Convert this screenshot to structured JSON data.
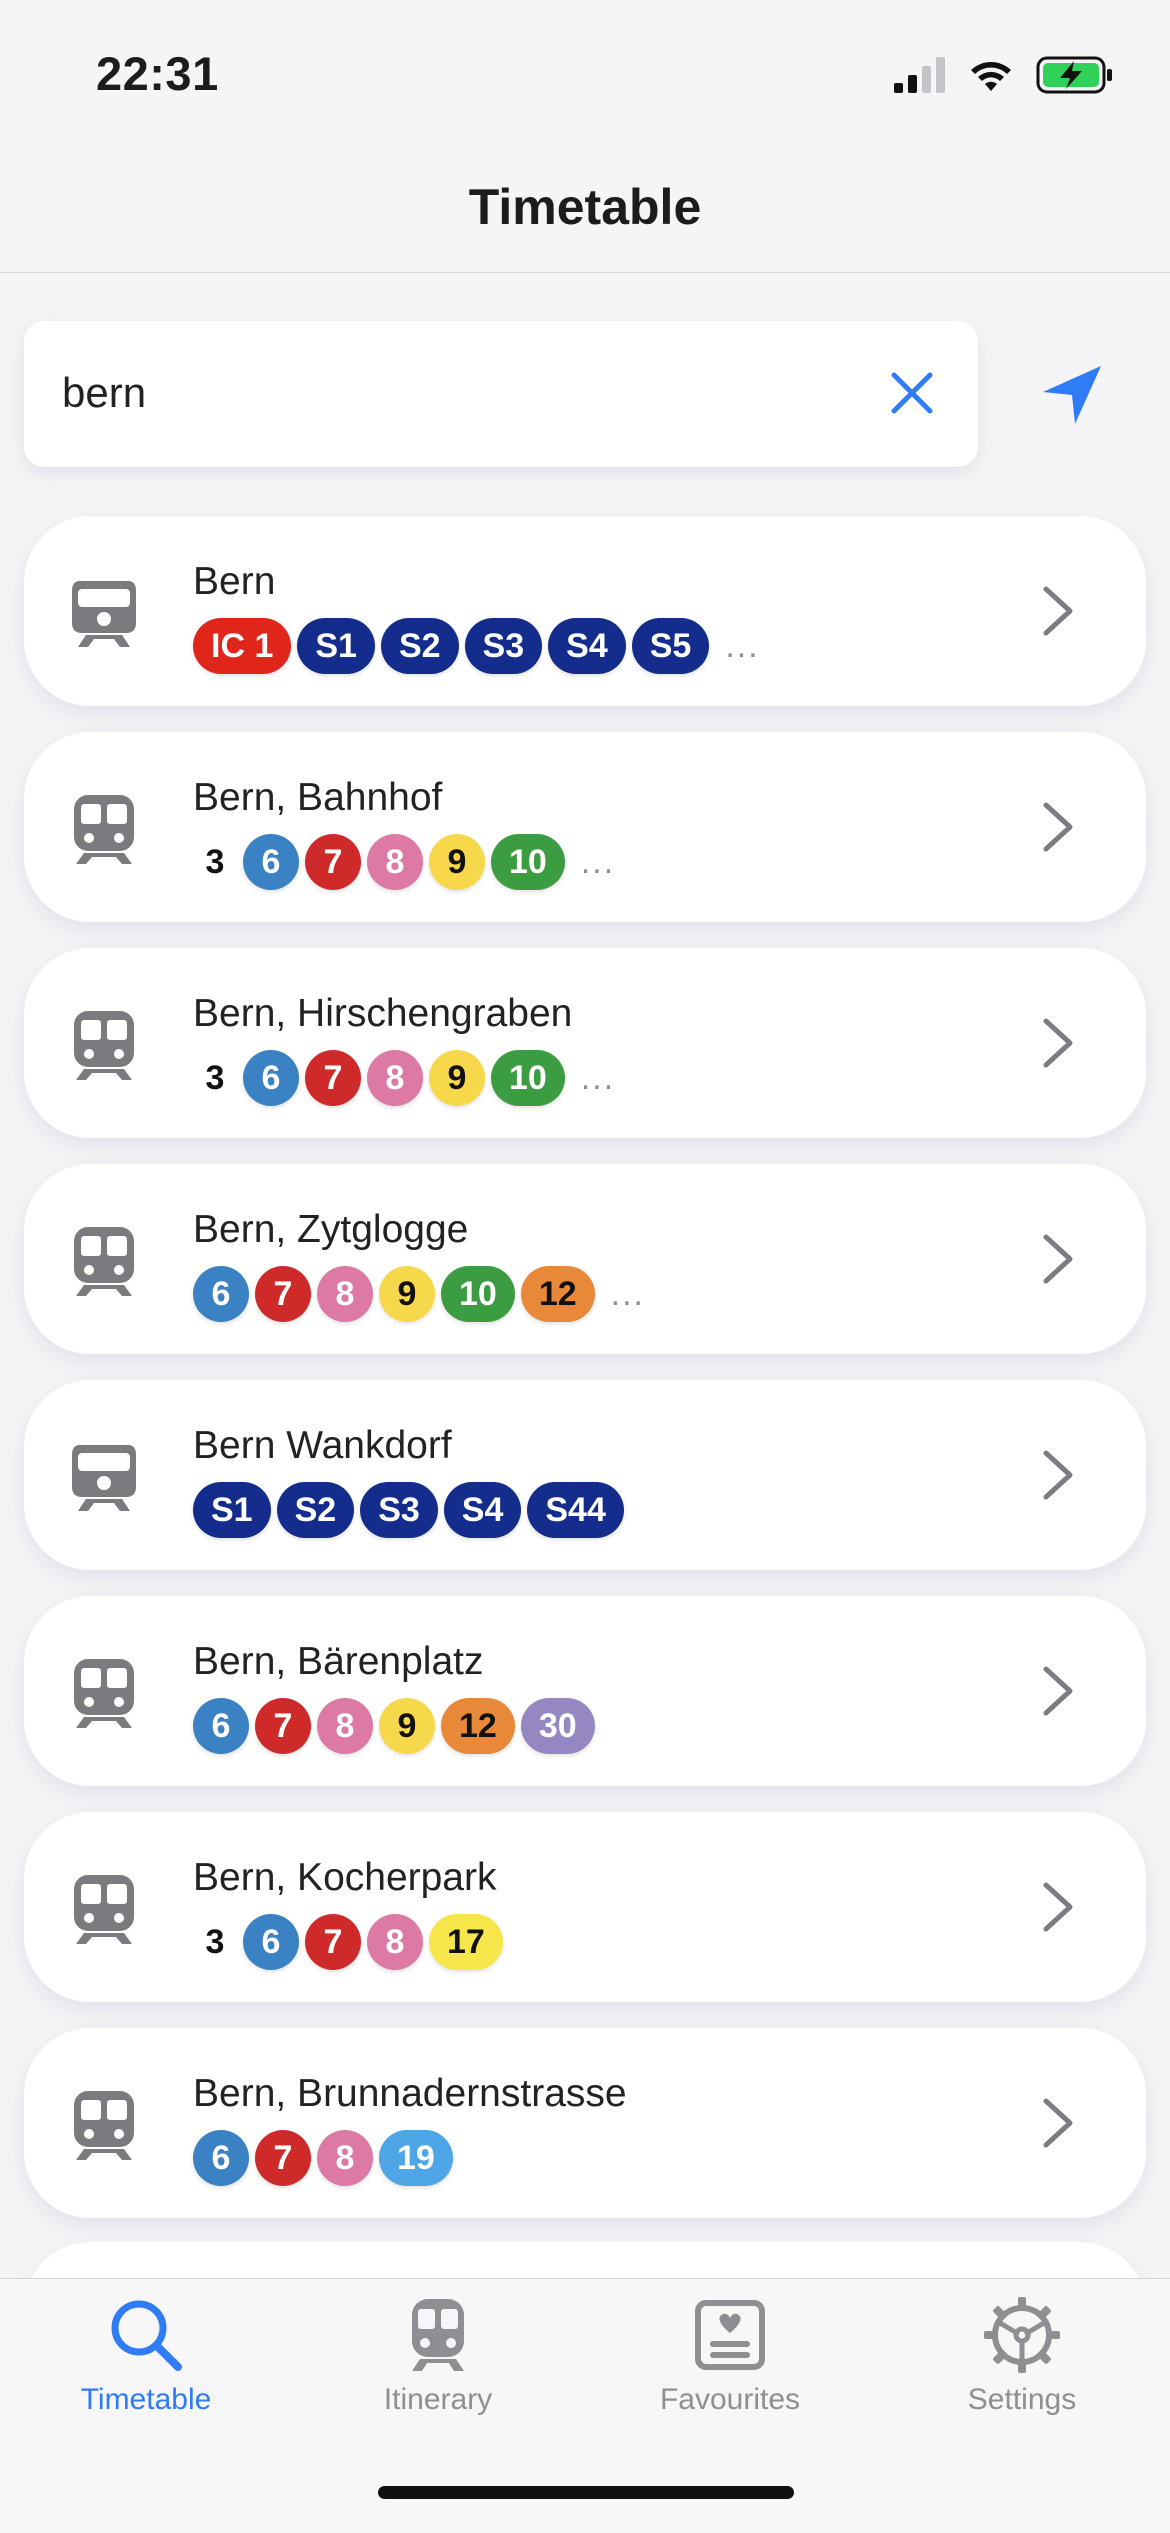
{
  "status": {
    "time": "22:31"
  },
  "nav": {
    "title": "Timetable"
  },
  "search": {
    "value": "bern",
    "clear_icon": "close-icon",
    "location_icon": "location-arrow-icon"
  },
  "colors": {
    "accent": "#2f7cf6",
    "card": "#ffffff",
    "background": "#f5f5f7"
  },
  "results": [
    {
      "name": "Bern",
      "icon": "train-icon",
      "lines": [
        {
          "label": "IC 1",
          "color": "#e0251b",
          "text": "#ffffff",
          "shape": "pill"
        },
        {
          "label": "S1",
          "color": "#142d8c",
          "text": "#ffffff",
          "shape": "pill"
        },
        {
          "label": "S2",
          "color": "#142d8c",
          "text": "#ffffff",
          "shape": "pill"
        },
        {
          "label": "S3",
          "color": "#142d8c",
          "text": "#ffffff",
          "shape": "pill"
        },
        {
          "label": "S4",
          "color": "#142d8c",
          "text": "#ffffff",
          "shape": "pill"
        },
        {
          "label": "S5",
          "color": "#142d8c",
          "text": "#ffffff",
          "shape": "pill"
        }
      ],
      "more": "..."
    },
    {
      "name": "Bern, Bahnhof",
      "icon": "tram-icon",
      "lines": [
        {
          "label": "3",
          "color": "transparent",
          "text": "#111111",
          "shape": "plain"
        },
        {
          "label": "6",
          "color": "#3a82c4",
          "text": "#ffffff",
          "shape": "circle"
        },
        {
          "label": "7",
          "color": "#cf2a2a",
          "text": "#ffffff",
          "shape": "circle"
        },
        {
          "label": "8",
          "color": "#dc7aa5",
          "text": "#ffffff",
          "shape": "circle"
        },
        {
          "label": "9",
          "color": "#f7d84a",
          "text": "#111111",
          "shape": "circle"
        },
        {
          "label": "10",
          "color": "#3c9c42",
          "text": "#ffffff",
          "shape": "pill"
        }
      ],
      "more": "..."
    },
    {
      "name": "Bern, Hirschengraben",
      "icon": "tram-icon",
      "lines": [
        {
          "label": "3",
          "color": "transparent",
          "text": "#111111",
          "shape": "plain"
        },
        {
          "label": "6",
          "color": "#3a82c4",
          "text": "#ffffff",
          "shape": "circle"
        },
        {
          "label": "7",
          "color": "#cf2a2a",
          "text": "#ffffff",
          "shape": "circle"
        },
        {
          "label": "8",
          "color": "#dc7aa5",
          "text": "#ffffff",
          "shape": "circle"
        },
        {
          "label": "9",
          "color": "#f7d84a",
          "text": "#111111",
          "shape": "circle"
        },
        {
          "label": "10",
          "color": "#3c9c42",
          "text": "#ffffff",
          "shape": "pill"
        }
      ],
      "more": "..."
    },
    {
      "name": "Bern, Zytglogge",
      "icon": "tram-icon",
      "lines": [
        {
          "label": "6",
          "color": "#3a82c4",
          "text": "#ffffff",
          "shape": "circle"
        },
        {
          "label": "7",
          "color": "#cf2a2a",
          "text": "#ffffff",
          "shape": "circle"
        },
        {
          "label": "8",
          "color": "#dc7aa5",
          "text": "#ffffff",
          "shape": "circle"
        },
        {
          "label": "9",
          "color": "#f7d84a",
          "text": "#111111",
          "shape": "circle"
        },
        {
          "label": "10",
          "color": "#3c9c42",
          "text": "#ffffff",
          "shape": "pill"
        },
        {
          "label": "12",
          "color": "#e8893a",
          "text": "#111111",
          "shape": "pill"
        }
      ],
      "more": "..."
    },
    {
      "name": "Bern Wankdorf",
      "icon": "train-icon",
      "lines": [
        {
          "label": "S1",
          "color": "#142d8c",
          "text": "#ffffff",
          "shape": "pill"
        },
        {
          "label": "S2",
          "color": "#142d8c",
          "text": "#ffffff",
          "shape": "pill"
        },
        {
          "label": "S3",
          "color": "#142d8c",
          "text": "#ffffff",
          "shape": "pill"
        },
        {
          "label": "S4",
          "color": "#142d8c",
          "text": "#ffffff",
          "shape": "pill"
        },
        {
          "label": "S44",
          "color": "#142d8c",
          "text": "#ffffff",
          "shape": "pill"
        }
      ],
      "more": ""
    },
    {
      "name": "Bern, Bärenplatz",
      "icon": "tram-icon",
      "lines": [
        {
          "label": "6",
          "color": "#3a82c4",
          "text": "#ffffff",
          "shape": "circle"
        },
        {
          "label": "7",
          "color": "#cf2a2a",
          "text": "#ffffff",
          "shape": "circle"
        },
        {
          "label": "8",
          "color": "#dc7aa5",
          "text": "#ffffff",
          "shape": "circle"
        },
        {
          "label": "9",
          "color": "#f7d84a",
          "text": "#111111",
          "shape": "circle"
        },
        {
          "label": "12",
          "color": "#e8893a",
          "text": "#111111",
          "shape": "pill"
        },
        {
          "label": "30",
          "color": "#9487c2",
          "text": "#ffffff",
          "shape": "pill"
        }
      ],
      "more": ""
    },
    {
      "name": "Bern, Kocherpark",
      "icon": "tram-icon",
      "lines": [
        {
          "label": "3",
          "color": "transparent",
          "text": "#111111",
          "shape": "plain"
        },
        {
          "label": "6",
          "color": "#3a82c4",
          "text": "#ffffff",
          "shape": "circle"
        },
        {
          "label": "7",
          "color": "#cf2a2a",
          "text": "#ffffff",
          "shape": "circle"
        },
        {
          "label": "8",
          "color": "#dc7aa5",
          "text": "#ffffff",
          "shape": "circle"
        },
        {
          "label": "17",
          "color": "#f7e64a",
          "text": "#111111",
          "shape": "pill"
        }
      ],
      "more": ""
    },
    {
      "name": "Bern, Brunnadernstrasse",
      "icon": "tram-icon",
      "lines": [
        {
          "label": "6",
          "color": "#3a82c4",
          "text": "#ffffff",
          "shape": "circle"
        },
        {
          "label": "7",
          "color": "#cf2a2a",
          "text": "#ffffff",
          "shape": "circle"
        },
        {
          "label": "8",
          "color": "#dc7aa5",
          "text": "#ffffff",
          "shape": "circle"
        },
        {
          "label": "19",
          "color": "#4ea6e6",
          "text": "#ffffff",
          "shape": "pill"
        }
      ],
      "more": ""
    }
  ],
  "tabs": [
    {
      "label": "Timetable",
      "icon": "search-icon",
      "active": true
    },
    {
      "label": "Itinerary",
      "icon": "tram-icon",
      "active": false
    },
    {
      "label": "Favourites",
      "icon": "favourites-icon",
      "active": false
    },
    {
      "label": "Settings",
      "icon": "gear-icon",
      "active": false
    }
  ]
}
